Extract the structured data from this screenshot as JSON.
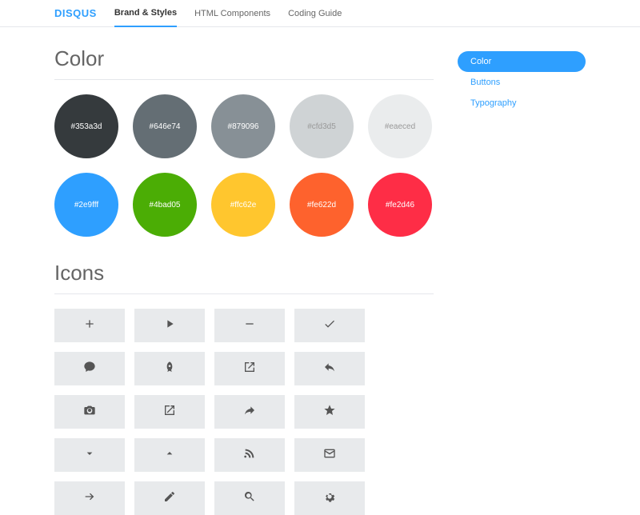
{
  "logo": "DISQUS",
  "nav": {
    "items": [
      {
        "label": "Brand & Styles",
        "active": true
      },
      {
        "label": "HTML Components",
        "active": false
      },
      {
        "label": "Coding Guide",
        "active": false
      }
    ]
  },
  "sidebar": {
    "items": [
      {
        "label": "Color",
        "active": true
      },
      {
        "label": "Buttons",
        "active": false
      },
      {
        "label": "Typography",
        "active": false
      }
    ]
  },
  "sections": {
    "color": {
      "title": "Color"
    },
    "icons": {
      "title": "Icons"
    }
  },
  "swatches": [
    {
      "hex": "#353a3d"
    },
    {
      "hex": "#646e74"
    },
    {
      "hex": "#879096"
    },
    {
      "hex": "#cfd3d5"
    },
    {
      "hex": "#eaeced"
    },
    {
      "hex": "#2e9fff"
    },
    {
      "hex": "#4bad05"
    },
    {
      "hex": "#ffc62e"
    },
    {
      "hex": "#fe622d"
    },
    {
      "hex": "#fe2d46"
    }
  ],
  "icons": [
    {
      "name": "plus-icon"
    },
    {
      "name": "play-icon"
    },
    {
      "name": "minus-icon"
    },
    {
      "name": "check-icon"
    },
    {
      "name": "comment-icon"
    },
    {
      "name": "rocket-icon"
    },
    {
      "name": "share-box-icon"
    },
    {
      "name": "reply-icon"
    },
    {
      "name": "camera-icon"
    },
    {
      "name": "external-link-icon"
    },
    {
      "name": "forward-icon"
    },
    {
      "name": "star-icon"
    },
    {
      "name": "chevron-down-icon"
    },
    {
      "name": "chevron-up-icon"
    },
    {
      "name": "rss-icon"
    },
    {
      "name": "mail-icon"
    },
    {
      "name": "arrow-right-icon"
    },
    {
      "name": "pencil-icon"
    },
    {
      "name": "search-icon"
    },
    {
      "name": "gear-icon"
    }
  ]
}
